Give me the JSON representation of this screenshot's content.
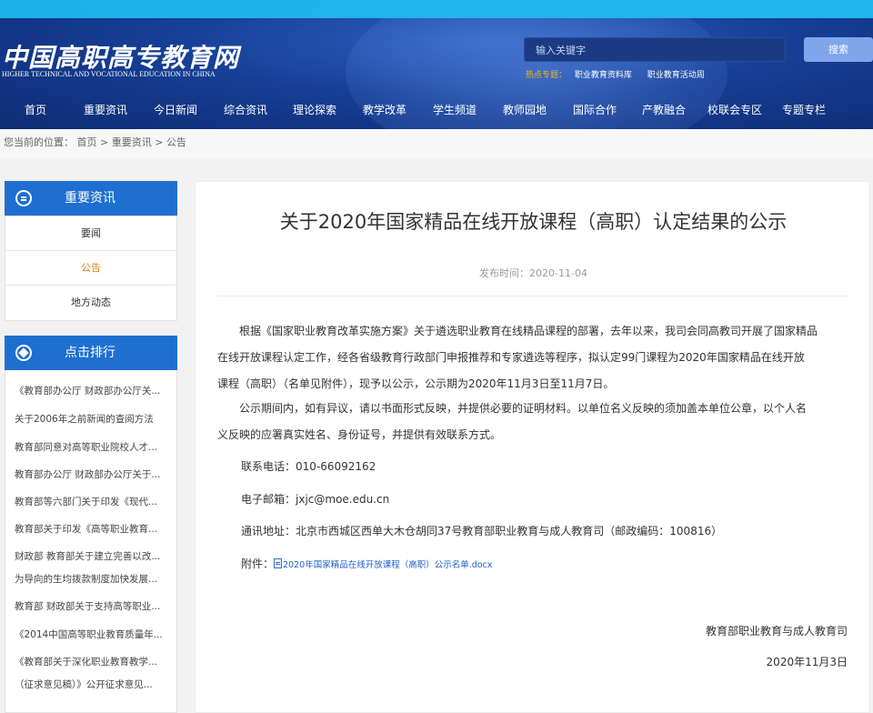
{
  "site": {
    "logo_cn": "中国高职高专教育网",
    "logo_en": "HIGHER TECHNICAL AND VOCATIONAL EDUCATION IN CHINA"
  },
  "search": {
    "placeholder": "输入关键字",
    "button_label": "搜索",
    "hot_label": "热点专题：",
    "hot_links": [
      "职业教育资料库",
      "职业教育活动周"
    ]
  },
  "nav": [
    "首页",
    "重要资讯",
    "今日新闻",
    "综合资讯",
    "理论探索",
    "教学改革",
    "学生频道",
    "教师园地",
    "国际合作",
    "产教融合",
    "校联会专区",
    "专题专栏"
  ],
  "breadcrumb": {
    "text": "您当前的位置：",
    "items": [
      "首页",
      "重要资讯",
      "公告"
    ],
    "separator": " > "
  },
  "sidebar": {
    "title": "重要资讯",
    "items": [
      {
        "label": "要闻"
      },
      {
        "label": "公告"
      },
      {
        "label": "地方动态"
      }
    ]
  },
  "ranking": {
    "title": "点击排行",
    "items": [
      "《教育部办公厅 财政部办公厅关...",
      "关于2006年之前新闻的查阅方法",
      "教育部同意对高等职业院校人才...",
      "教育部办公厅 财政部办公厅关于...",
      "教育部等六部门关于印发《现代...",
      "教育部关于印发《高等职业教育...",
      "财政部 教育部关于建立完善以改...",
      "为导向的生均拨款制度加快发展...",
      "教育部 财政部关于支持高等职业...",
      "《2014中国高等职业教育质量年...",
      "《教育部关于深化职业教育教学...",
      "（征求意见稿）》公开征求意见..."
    ]
  },
  "article": {
    "title": "关于2020年国家精品在线开放课程（高职）认定结果的公示",
    "pub_label": "发布时间：",
    "pub_date": "2020-11-04",
    "para1_l1": "根据《国家职业教育改革实施方案》关于遴选职业教育在线精品课程的部署，去年以来，我司会同高教司开展了国家精品",
    "para1_l2": "在线开放课程认定工作，经各省级教育行政部门申报推荐和专家遴选等程序，拟认定99门课程为2020年国家精品在线开放",
    "para1_l3": "课程（高职）（名单见附件），现予以公示，公示期为2020年11月3日至11月7日。",
    "para2_l1": "公示期间内，如有异议，请以书面形式反映，并提供必要的证明材料。以单位名义反映的须加盖本单位公章，以个人名",
    "para2_l2": "义反映的应署真实姓名、身份证号，并提供有效联系方式。",
    "phone_label": "联系电话：",
    "phone": "010-66092162",
    "email_label": "电子邮箱：",
    "email": "jxjc@moe.edu.cn",
    "address_label": "通讯地址：",
    "address": "北京市西城区西单大木仓胡同37号教育部职业教育与成人教育司（邮政编码：100816）",
    "attachment_label": "附件：",
    "attachment_file": "2020年国家精品在线开放课程（高职）公示名单.docx",
    "signature_org": "教育部职业教育与成人教育司",
    "signature_date": "2020年11月3日"
  },
  "colors": {
    "banner": "#163f96",
    "topstrip": "#1fb2ea",
    "sidebar_header": "#1f6fd0",
    "active_link": "#e0861a",
    "hot_label": "#f4b81e",
    "link": "#1f5fc9"
  }
}
